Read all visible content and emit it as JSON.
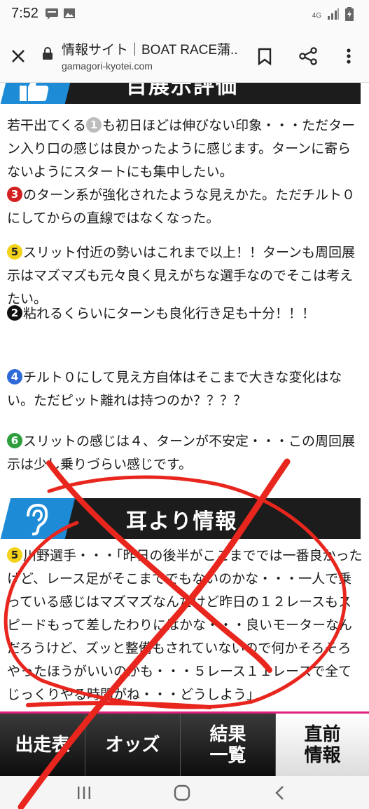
{
  "status_bar": {
    "time": "7:52",
    "network": "4G",
    "icons": [
      "sms-icon",
      "image-icon",
      "signal-icon",
      "battery-icon"
    ]
  },
  "browser": {
    "page_title": "情報サイト｜BOAT RACE蒲...",
    "url": "gamagori-kyotei.com",
    "icons": [
      "close-icon",
      "lock-icon",
      "bookmark-icon",
      "share-icon",
      "more-icon"
    ]
  },
  "sections": {
    "exhibition_title": "目展示評価",
    "rumor_title": "耳より情報"
  },
  "comments": [
    {
      "badge": "1",
      "pre": "若干出てくる",
      "text": "も初日ほどは伸びない印象・・・ただターン入り口の感じは良かったように感じます。ターンに寄らないようにスタートにも集中したい。"
    },
    {
      "badge": "3",
      "pre": "",
      "text": "のターン系が強化されたような見えかた。ただチルト０にしてからの直線ではなくなった。"
    },
    {
      "badge": "5",
      "pre": "",
      "text": "スリット付近の勢いはこれまで以上！！ターンも周回展示はマズマズも元々良く見えがちな選手なのでそこは考えたい。"
    },
    {
      "badge": "2",
      "pre": "",
      "text": "粘れるくらいにターンも良化行き足も十分！！！"
    },
    {
      "badge": "4",
      "pre": "",
      "text": "チルト０にして見え方自体はそこまで大きな変化はない。ただピット離れは持つのか？？？？"
    },
    {
      "badge": "6",
      "pre": "",
      "text": "スリットの感じは４、ターンが不安定・・・この周回展示は少し乗りづらい感じです。"
    }
  ],
  "rumor": {
    "badge": "5",
    "text": "川野選手・・・「昨日の後半がここまででは一番良かったけど、レース足がそこまででもないのかな・・・一人で乗っている感じはマズマズなんだけど昨日の１２レースもスピードもって差したわりにはかな・・・良いモーターなんだろうけど、ズッと整備もされていないので何かそろそろやったほうがいいのかも・・・５レース１１レースで全てじっくりやる時間がね・・・どうしよう」"
  },
  "site_nav": {
    "tabs": [
      {
        "label": "出走表",
        "active": false
      },
      {
        "label": "オッズ",
        "active": false
      },
      {
        "label": "結果\n一覧",
        "active": false
      },
      {
        "label": "直前\n情報",
        "active": true
      }
    ]
  },
  "android_nav": [
    "recents-icon",
    "home-icon",
    "back-icon"
  ],
  "colors": {
    "accent_pink": "#e0207a",
    "header_blue": "#1d8bd6",
    "scribble_red": "#e8261e"
  }
}
